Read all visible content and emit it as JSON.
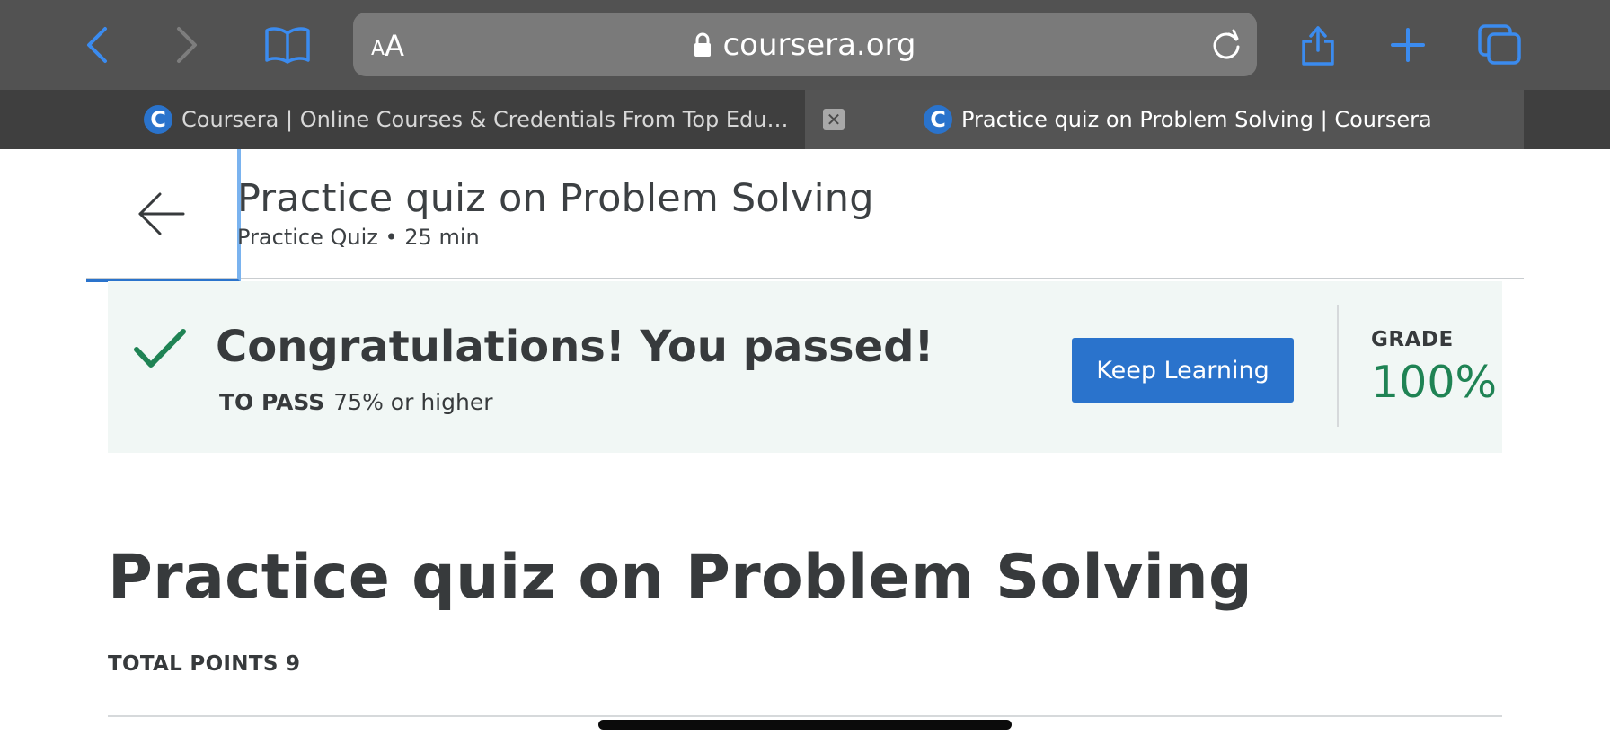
{
  "browser": {
    "url": "coursera.org",
    "text_size_small": "A",
    "text_size_large": "A"
  },
  "tabs": [
    {
      "title": "Coursera | Online Courses & Credentials From Top Edu…",
      "favicon": "C"
    },
    {
      "title": "Practice quiz on Problem Solving | Coursera",
      "favicon": "C",
      "close_symbol": "✕"
    }
  ],
  "header": {
    "title": "Practice quiz on Problem Solving",
    "subtitle": "Practice Quiz • 25 min"
  },
  "banner": {
    "title": "Congratulations! You passed!",
    "to_pass_label": "TO PASS",
    "to_pass_value": "75% or higher",
    "button_label": "Keep Learning",
    "grade_label": "GRADE",
    "grade_value": "100%"
  },
  "main": {
    "title": "Practice quiz on Problem Solving",
    "total_points": "TOTAL POINTS 9"
  },
  "colors": {
    "accent_blue": "#2a73cc",
    "success_green": "#1f8354",
    "banner_bg": "#f1f7f5",
    "toolbar_blue": "#3b8bef"
  },
  "icons": [
    "back-arrow-icon",
    "forward-arrow-icon",
    "bookmarks-icon",
    "lock-icon",
    "reload-icon",
    "share-icon",
    "new-tab-icon",
    "tabs-overview-icon",
    "checkmark-icon",
    "page-back-arrow-icon"
  ]
}
